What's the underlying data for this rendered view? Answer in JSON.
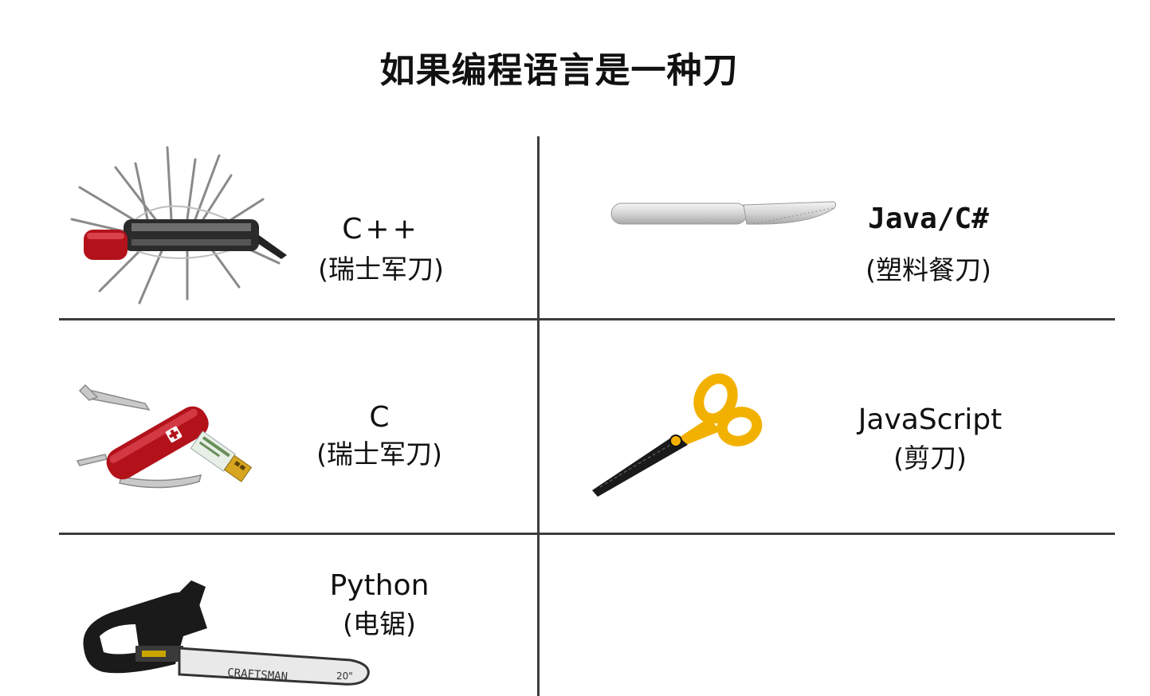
{
  "title": "如果编程语言是一种刀",
  "cells": {
    "cpp": {
      "language": "C++",
      "description": "(瑞士军刀)",
      "icon": "swiss-army-knife-giant-icon"
    },
    "java": {
      "language": "Java/C#",
      "description": "(塑料餐刀)",
      "icon": "plastic-knife-icon"
    },
    "c": {
      "language": "C",
      "description": "(瑞士军刀)",
      "icon": "swiss-army-knife-usb-icon"
    },
    "javascript": {
      "language": "JavaScript",
      "description": "(剪刀)",
      "icon": "scissors-icon"
    },
    "python": {
      "language": "Python",
      "description": "(电锯)",
      "icon": "chainsaw-icon",
      "brand": "CRAFTSMAN",
      "bar_size": "20\""
    }
  },
  "colors": {
    "grid_line": "#3d3d3d",
    "knife_red": "#b3121b",
    "scissors_yellow": "#f2b100",
    "chainsaw_black": "#1a1a1a"
  }
}
